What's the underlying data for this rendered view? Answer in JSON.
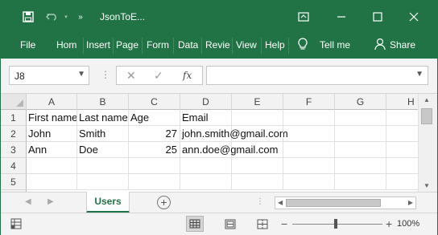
{
  "title": {
    "doc_name": "JsonToE..."
  },
  "ribbon": {
    "tabs": [
      "File",
      "Hom",
      "Insert",
      "Page",
      "Form",
      "Data",
      "Revie",
      "View",
      "Help"
    ],
    "tell_me": "Tell me",
    "share": "Share"
  },
  "formula_bar": {
    "name_box": "J8",
    "formula_value": ""
  },
  "sheet": {
    "column_headers": [
      "A",
      "B",
      "C",
      "D",
      "E",
      "F",
      "G",
      "H"
    ],
    "row_headers": [
      "1",
      "2",
      "3",
      "4",
      "5"
    ],
    "rows": [
      [
        "First name",
        "Last name",
        "Age",
        "Email"
      ],
      [
        "John",
        "Smith",
        "27",
        "john.smith@gmail.com"
      ],
      [
        "Ann",
        "Doe",
        "25",
        "ann.doe@gmail.com"
      ]
    ]
  },
  "sheet_tabs": {
    "active": "Users"
  },
  "status_bar": {
    "zoom_label": "100%",
    "zoom_percent": 100
  },
  "colors": {
    "brand": "#217346"
  }
}
